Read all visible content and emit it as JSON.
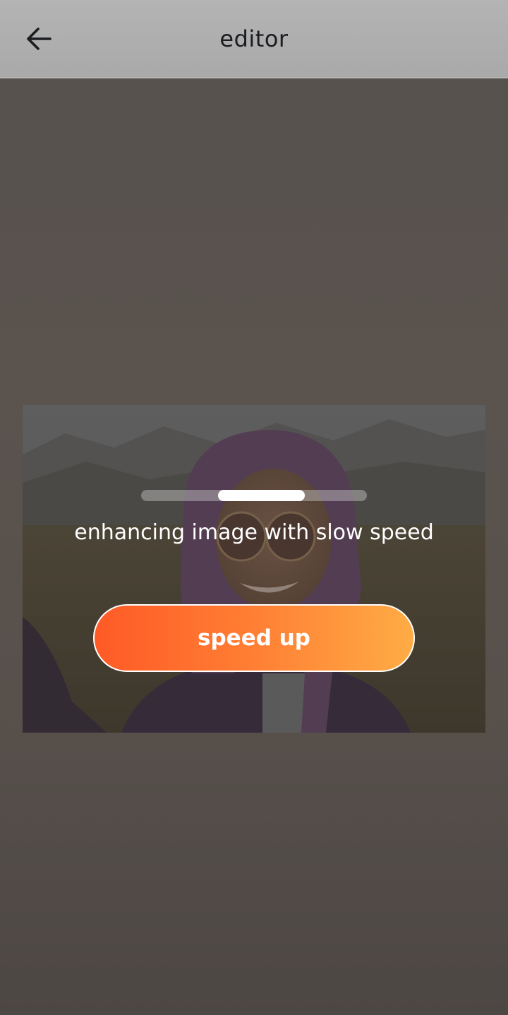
{
  "app_bar": {
    "title": "editor",
    "back_icon": "arrow-left-icon"
  },
  "colors": {
    "app_bar_bg": "#b0b0b0",
    "overlay_bg": "#56514d",
    "button_gradient_start": "#ff5a26",
    "button_gradient_end": "#ffac45",
    "text": "#ffffff"
  },
  "enhance": {
    "status_text": "enhancing image with slow speed",
    "progress": 0.35,
    "progress_style": "indeterminate",
    "speed_up_label": "speed up"
  },
  "photo": {
    "subject_icon": "woman-in-purple-hijab-with-sunglasses-selfie-photo"
  }
}
